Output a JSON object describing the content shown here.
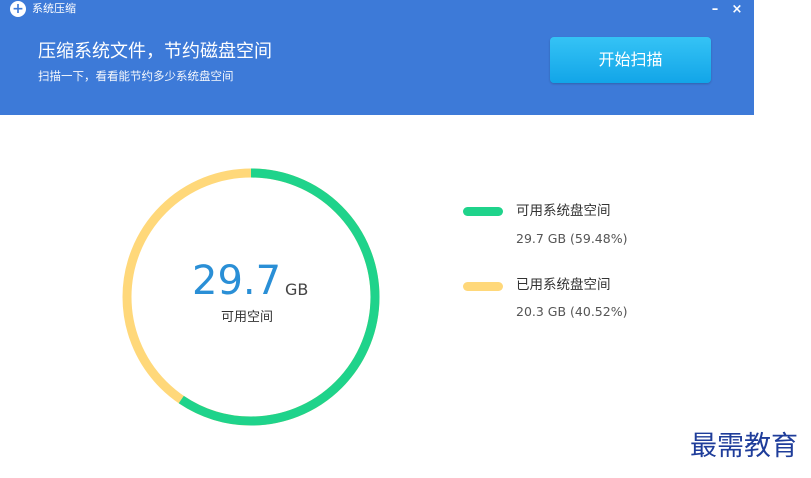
{
  "window": {
    "title": "系统压缩",
    "icon": "plus-circle-icon",
    "minimize_label": "–",
    "close_label": "×"
  },
  "header": {
    "headline": "压缩系统文件，节约磁盘空间",
    "subline": "扫描一下，看看能节约多少系统盘空间",
    "scan_button_label": "开始扫描",
    "background_color": "#3d7ad8",
    "button_color": "#1fb2ee"
  },
  "disk": {
    "center_value": "29.7",
    "center_unit": "GB",
    "center_label": "可用空间",
    "legend": [
      {
        "title": "可用系统盘空间",
        "detail": "29.7 GB  (59.48%)",
        "fraction": 0.5948,
        "color": "#1fd38b"
      },
      {
        "title": "已用系统盘空间",
        "detail": "20.3 GB  (40.52%)",
        "fraction": 0.4052,
        "color": "#ffd87a"
      }
    ]
  },
  "watermark": "最需教育"
}
